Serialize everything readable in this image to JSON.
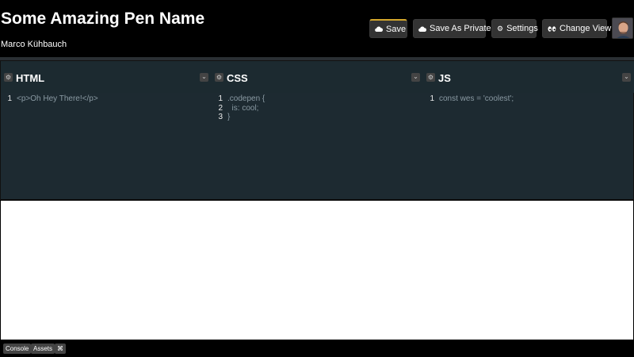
{
  "pen": {
    "title": "Some Amazing Pen Name",
    "author": "Marco Kühbauch"
  },
  "toolbar": {
    "save_label": "Save",
    "save_private_label": "Save As Private",
    "settings_label": "Settings",
    "change_view_label": "Change View"
  },
  "icons": {
    "save": "cloud-icon",
    "save_private": "cloud-icon",
    "settings": "gear-icon",
    "change_view": "eyes-icon"
  },
  "colors": {
    "accent": "#d4a72c",
    "editor_bg": "#1d2a31",
    "button_bg": "#333333",
    "code_text": "#8a9aa3"
  },
  "editors": [
    {
      "language": "HTML",
      "lines": [
        {
          "num": "1",
          "text": "<p>Oh Hey There!</p>"
        }
      ]
    },
    {
      "language": "CSS",
      "lines": [
        {
          "num": "1",
          "text": ".codepen {"
        },
        {
          "num": "2",
          "text": "  is: cool;"
        },
        {
          "num": "3",
          "text": "}"
        }
      ]
    },
    {
      "language": "JS",
      "lines": [
        {
          "num": "1",
          "text": "const wes = 'coolest';"
        }
      ]
    }
  ],
  "footer": {
    "console_label": "Console",
    "assets_label": "Assets",
    "shortcuts_label": "⌘"
  }
}
